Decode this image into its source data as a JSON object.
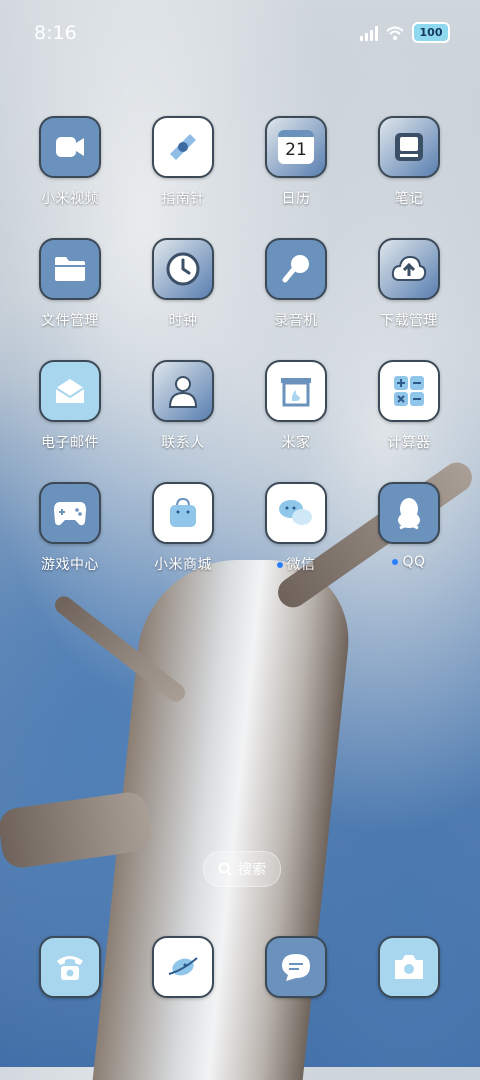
{
  "status_bar": {
    "time": "8:16",
    "battery": "100"
  },
  "apps": [
    {
      "label": "小米视频",
      "icon": "video-camera-icon",
      "style": "blue"
    },
    {
      "label": "指南针",
      "icon": "compass-icon",
      "style": "white"
    },
    {
      "label": "日历",
      "icon": "calendar-icon",
      "style": "photo",
      "day": "21"
    },
    {
      "label": "笔记",
      "icon": "notes-icon",
      "style": "photo"
    },
    {
      "label": "文件管理",
      "icon": "folder-icon",
      "style": "blue"
    },
    {
      "label": "时钟",
      "icon": "clock-icon",
      "style": "photo"
    },
    {
      "label": "录音机",
      "icon": "microphone-icon",
      "style": "blue"
    },
    {
      "label": "下载管理",
      "icon": "cloud-download-icon",
      "style": "photo"
    },
    {
      "label": "电子邮件",
      "icon": "mail-icon",
      "style": "light"
    },
    {
      "label": "联系人",
      "icon": "contact-person-icon",
      "style": "photo"
    },
    {
      "label": "米家",
      "icon": "home-fireplace-icon",
      "style": "white"
    },
    {
      "label": "计算器",
      "icon": "calculator-icon",
      "style": "white"
    },
    {
      "label": "游戏中心",
      "icon": "gamepad-icon",
      "style": "blue"
    },
    {
      "label": "小米商城",
      "icon": "shopping-bag-icon",
      "style": "white"
    },
    {
      "label": "微信",
      "icon": "chat-bubbles-icon",
      "style": "white",
      "notify": true
    },
    {
      "label": "QQ",
      "icon": "penguin-icon",
      "style": "blue",
      "notify": true
    }
  ],
  "search": {
    "label": "搜索"
  },
  "dock": [
    {
      "icon": "phone-icon",
      "style": "light"
    },
    {
      "icon": "browser-icon",
      "style": "white"
    },
    {
      "icon": "messages-icon",
      "style": "blue"
    },
    {
      "icon": "camera-icon",
      "style": "light"
    }
  ]
}
